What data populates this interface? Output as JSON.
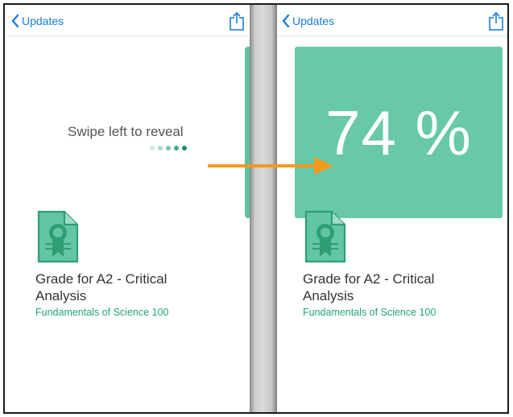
{
  "nav": {
    "back_label": "Updates"
  },
  "left_screen": {
    "swipe_hint": "Swipe left to reveal",
    "dots": [
      {
        "color": "#cfe9df"
      },
      {
        "color": "#a9dcc8"
      },
      {
        "color": "#79c7a9"
      },
      {
        "color": "#3fae85"
      },
      {
        "color": "#1f8a63"
      }
    ]
  },
  "right_screen": {
    "grade_value": "74 %"
  },
  "update": {
    "title_line1": "Grade for A2 - Critical",
    "title_line2": "Analysis",
    "course": "Fundamentals of Science 100"
  },
  "colors": {
    "accent_green": "#67c9a9",
    "link_blue": "#1a7ee0",
    "arrow_orange": "#f39a1c"
  },
  "icons": [
    "chevron-left-icon",
    "share-icon",
    "certificate-icon",
    "arrow-right-icon"
  ]
}
